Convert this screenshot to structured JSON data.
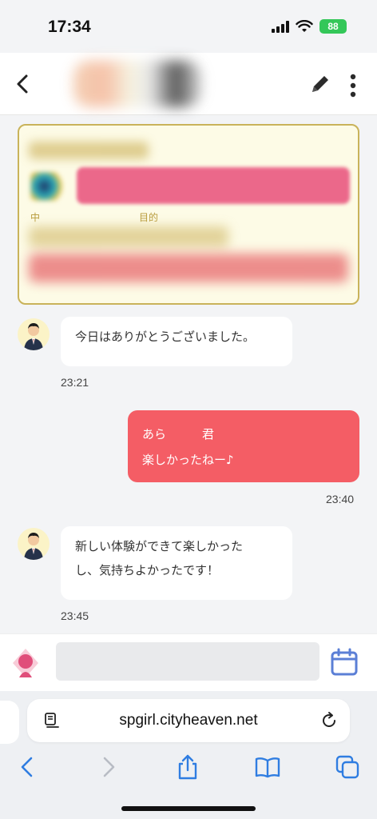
{
  "status_bar": {
    "time": "17:34",
    "battery": "88"
  },
  "header": {
    "back_icon": "chevron-left-icon",
    "edit_icon": "pencil-icon",
    "more_icon": "more-vertical-icon"
  },
  "info_card": {
    "label_left": "中",
    "label_right": "目的"
  },
  "messages": [
    {
      "direction": "in",
      "text": "今日はありがとうございました。",
      "time": "23:21"
    },
    {
      "direction": "out",
      "lines": [
        "あら　　　君",
        "楽しかったねー♪"
      ],
      "time": "23:40"
    },
    {
      "direction": "in",
      "lines": [
        "新しい体験ができて楽しかった",
        "し、気持ちよかったです！"
      ],
      "time": "23:45"
    }
  ],
  "input_bar": {
    "calendar_icon": "calendar-icon"
  },
  "browser": {
    "url": "spgirl.cityheaven.net",
    "icons": [
      "reader-icon",
      "reload-icon",
      "back-icon",
      "forward-icon",
      "share-icon",
      "bookmarks-icon",
      "tabs-icon"
    ]
  },
  "colors": {
    "accent_pink": "#f45d65",
    "link_blue": "#2f7de1",
    "card_gold": "#c9b35a"
  }
}
